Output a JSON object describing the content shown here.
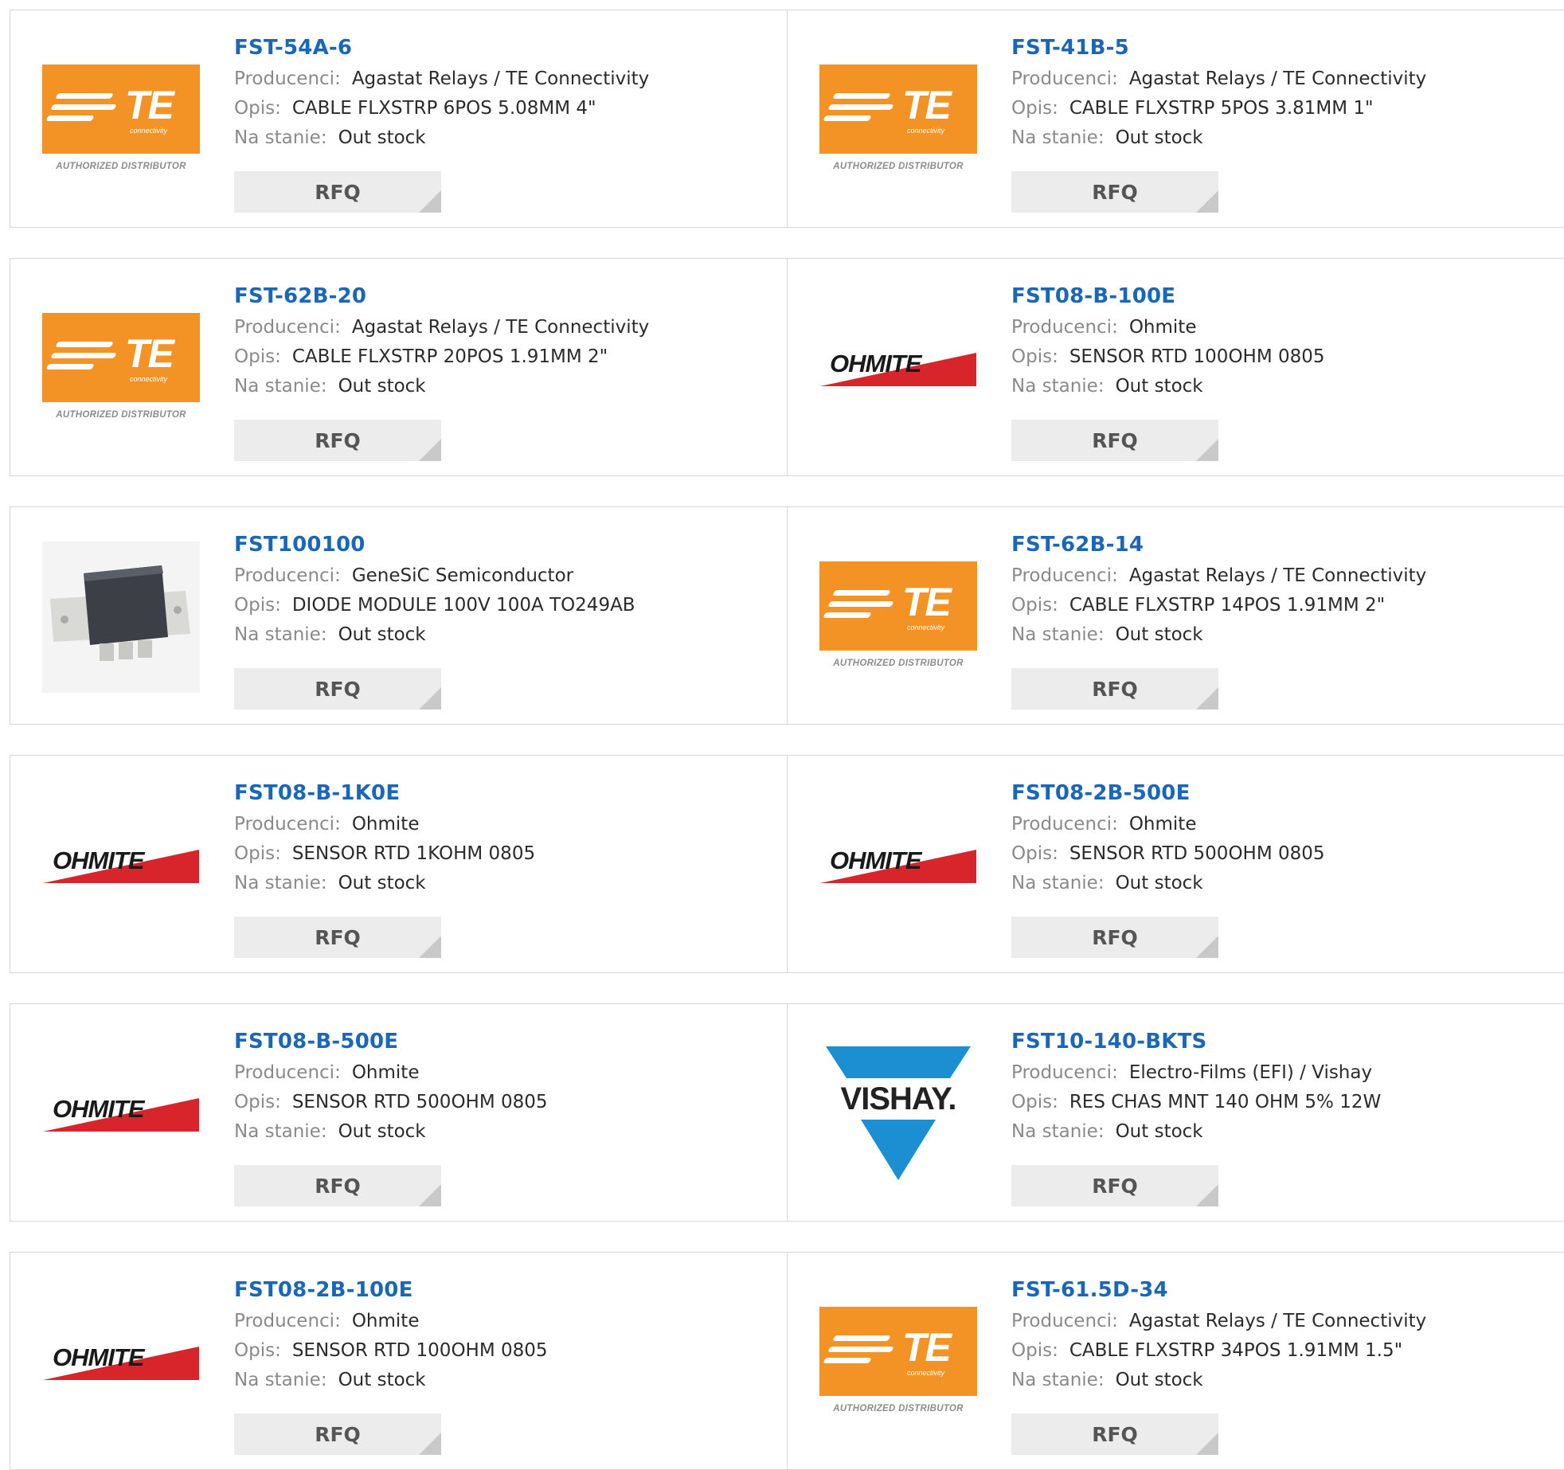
{
  "labels": {
    "manufacturer": "Producenci:",
    "description": "Opis:",
    "stock": "Na stanie:",
    "rfq": "RFQ"
  },
  "logos": {
    "te": {
      "mark": "TE",
      "sub": "connectivity",
      "authorized": "AUTHORIZED DISTRIBUTOR"
    },
    "ohmite": {
      "text": "OHMITE"
    },
    "vishay": {
      "text": "VISHAY."
    }
  },
  "colors": {
    "part_link": "#1a66b8",
    "te_orange": "#f39325",
    "ohmite_red": "#d8252b",
    "vishay_blue": "#1b8fd2",
    "rfq_bg": "#ececec"
  },
  "products": [
    {
      "part": "FST-54A-6",
      "logo": "te",
      "manufacturer": "Agastat Relays / TE Connectivity",
      "description": "CABLE FLXSTRP 6POS 5.08MM 4\"",
      "stock": "Out stock"
    },
    {
      "part": "FST-41B-5",
      "logo": "te",
      "manufacturer": "Agastat Relays / TE Connectivity",
      "description": "CABLE FLXSTRP 5POS 3.81MM 1\"",
      "stock": "Out stock"
    },
    {
      "part": "FST-62B-20",
      "logo": "te",
      "manufacturer": "Agastat Relays / TE Connectivity",
      "description": "CABLE FLXSTRP 20POS 1.91MM 2\"",
      "stock": "Out stock"
    },
    {
      "part": "FST08-B-100E",
      "logo": "ohmite",
      "manufacturer": "Ohmite",
      "description": "SENSOR RTD 100OHM 0805",
      "stock": "Out stock"
    },
    {
      "part": "FST100100",
      "logo": "module",
      "manufacturer": "GeneSiC Semiconductor",
      "description": "DIODE MODULE 100V 100A TO249AB",
      "stock": "Out stock"
    },
    {
      "part": "FST-62B-14",
      "logo": "te",
      "manufacturer": "Agastat Relays / TE Connectivity",
      "description": "CABLE FLXSTRP 14POS 1.91MM 2\"",
      "stock": "Out stock"
    },
    {
      "part": "FST08-B-1K0E",
      "logo": "ohmite",
      "manufacturer": "Ohmite",
      "description": "SENSOR RTD 1KOHM 0805",
      "stock": "Out stock"
    },
    {
      "part": "FST08-2B-500E",
      "logo": "ohmite",
      "manufacturer": "Ohmite",
      "description": "SENSOR RTD 500OHM 0805",
      "stock": "Out stock"
    },
    {
      "part": "FST08-B-500E",
      "logo": "ohmite",
      "manufacturer": "Ohmite",
      "description": "SENSOR RTD 500OHM 0805",
      "stock": "Out stock"
    },
    {
      "part": "FST10-140-BKTS",
      "logo": "vishay",
      "manufacturer": "Electro-Films (EFI) / Vishay",
      "description": "RES CHAS MNT 140 OHM 5% 12W",
      "stock": "Out stock"
    },
    {
      "part": "FST08-2B-100E",
      "logo": "ohmite",
      "manufacturer": "Ohmite",
      "description": "SENSOR RTD 100OHM 0805",
      "stock": "Out stock"
    },
    {
      "part": "FST-61.5D-34",
      "logo": "te",
      "manufacturer": "Agastat Relays / TE Connectivity",
      "description": "CABLE FLXSTRP 34POS 1.91MM 1.5\"",
      "stock": "Out stock"
    }
  ]
}
